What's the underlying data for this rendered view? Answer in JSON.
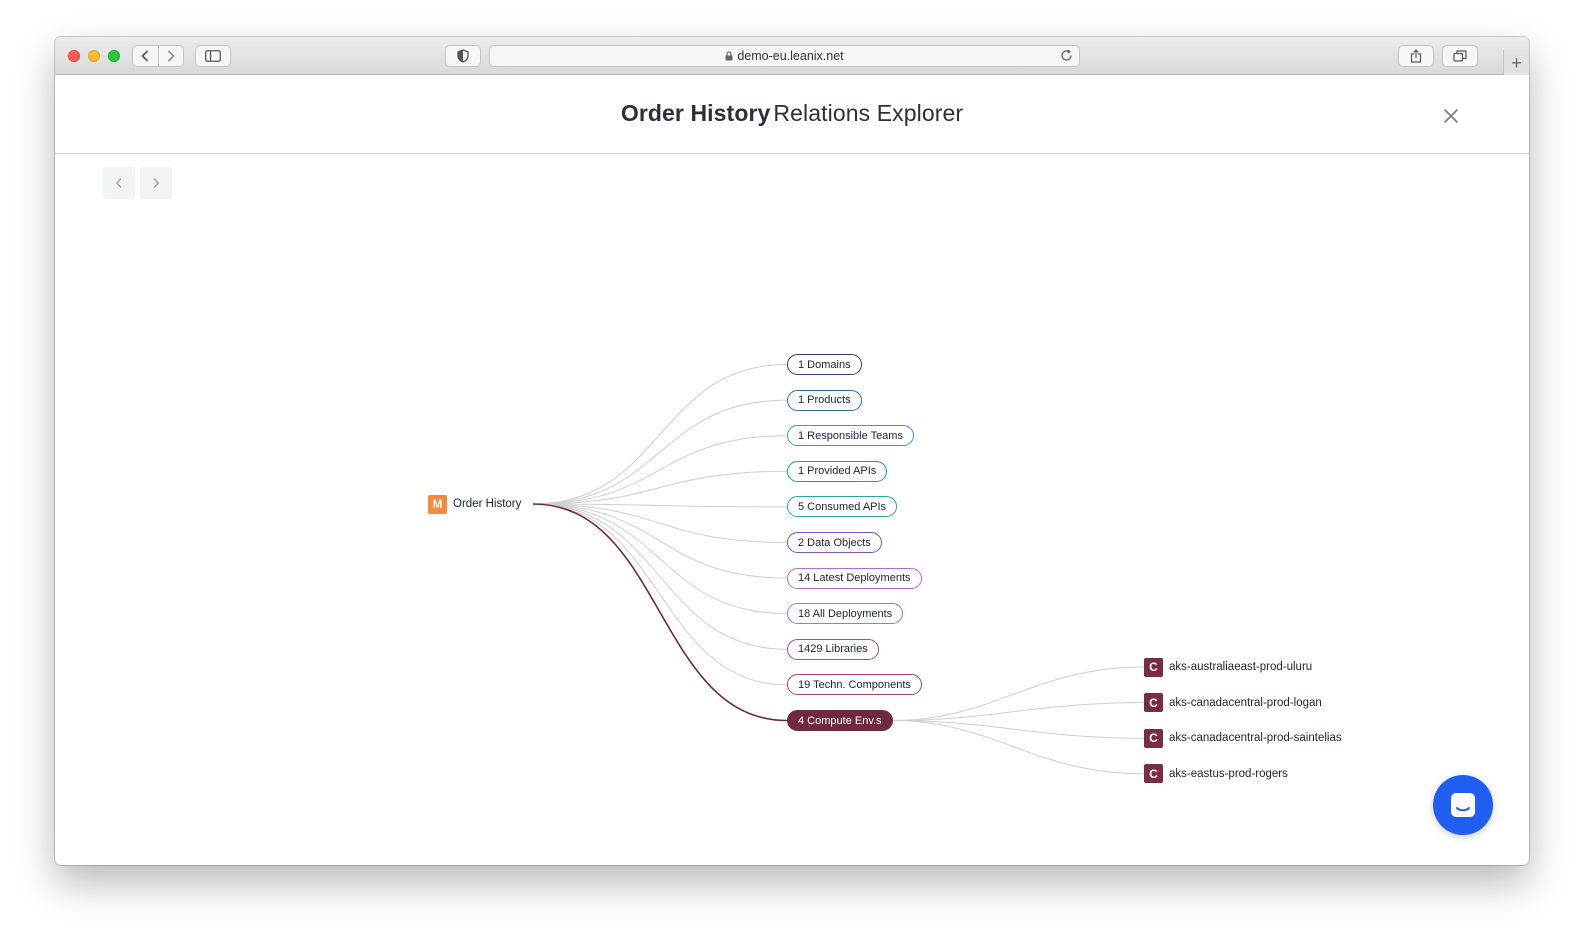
{
  "browser": {
    "url": "demo-eu.leanix.net"
  },
  "modal": {
    "title_strong": "Order History",
    "title_light": "Relations Explorer"
  },
  "graph": {
    "root": {
      "badge": "M",
      "label": "Order History",
      "color": "#f6893c"
    },
    "relations": [
      {
        "label": "1 Domains",
        "color": "#2d3f7a",
        "active": false
      },
      {
        "label": "1 Products",
        "color": "#2b6fa8",
        "active": false
      },
      {
        "label": "1 Responsible Teams",
        "color": "#3e8fe0",
        "active": false
      },
      {
        "label": "1 Provided APIs",
        "color": "#1f9a96",
        "active": false
      },
      {
        "label": "5 Consumed APIs",
        "color": "#2aa7a0",
        "active": false
      },
      {
        "label": "2 Data Objects",
        "color": "#7d4fc2",
        "active": false
      },
      {
        "label": "14 Latest Deployments",
        "color": "#b46ad8",
        "active": false
      },
      {
        "label": "18 All Deployments",
        "color": "#b46ad8",
        "active": false
      },
      {
        "label": "1429 Libraries",
        "color": "#a04f9a",
        "active": false
      },
      {
        "label": "19 Techn. Components",
        "color": "#a8406a",
        "active": false
      },
      {
        "label": "4 Compute Env.s",
        "color": "#6e2840",
        "active": true
      }
    ],
    "children": [
      {
        "badge": "C",
        "label": "aks-australiaeast-prod-uluru"
      },
      {
        "badge": "C",
        "label": "aks-canadacentral-prod-logan"
      },
      {
        "badge": "C",
        "label": "aks-canadacentral-prod-saintelias"
      },
      {
        "badge": "C",
        "label": "aks-eastus-prod-rogers"
      }
    ],
    "active_edge_color": "#6e2840",
    "edge_color": "#cfcfcf"
  },
  "icons": {
    "chat": "chat-icon",
    "close": "close-icon"
  }
}
